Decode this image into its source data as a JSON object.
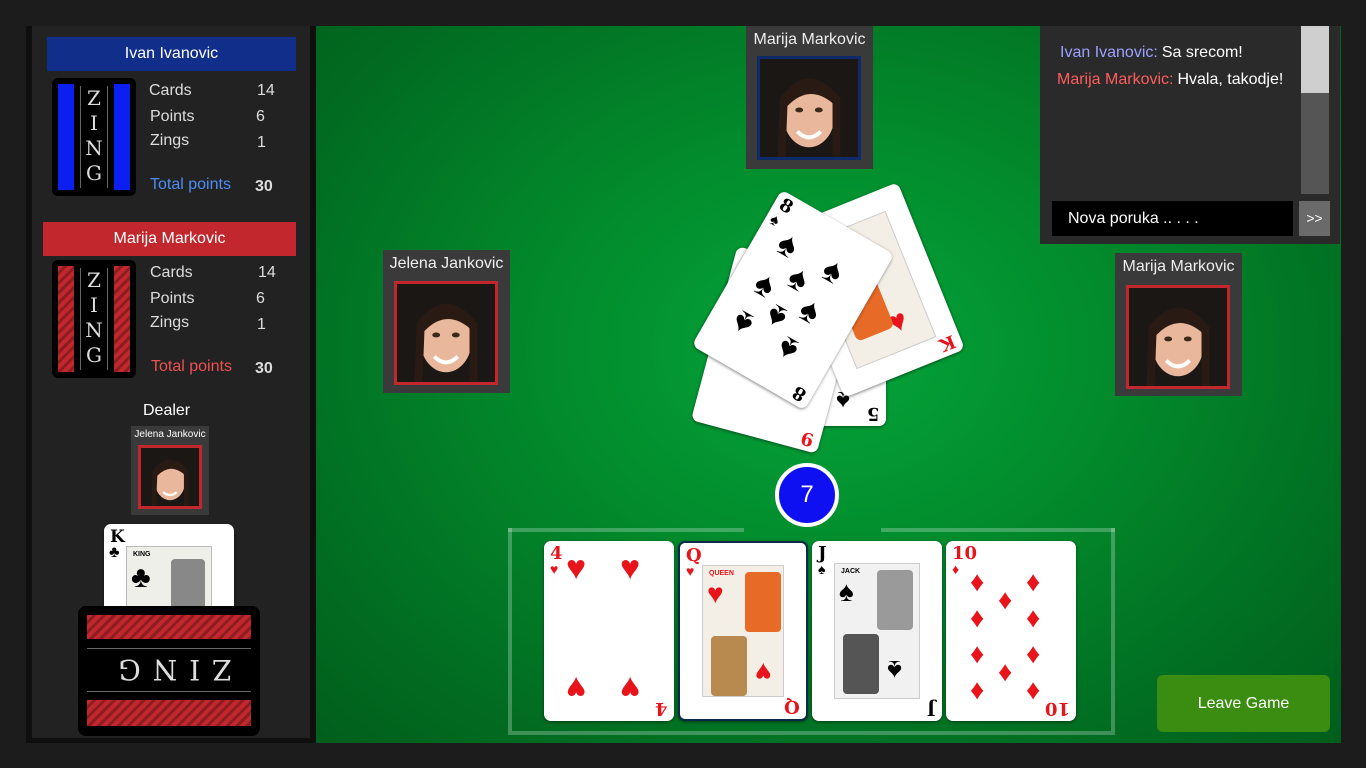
{
  "teams": [
    {
      "name": "Ivan Ivanovic",
      "header_color": "#112e8a",
      "deck_style": "blue",
      "deck_word": [
        "Z",
        "I",
        "N",
        "G"
      ],
      "stats": [
        {
          "label": "Cards",
          "value": "14"
        },
        {
          "label": "Points",
          "value": "6"
        },
        {
          "label": "Zings",
          "value": "1"
        }
      ],
      "total_label": "Total points",
      "total_value": "30",
      "total_color": "#4b8ef5"
    },
    {
      "name": "Marija Markovic",
      "header_color": "#c1272d",
      "deck_style": "red",
      "deck_word": [
        "Z",
        "I",
        "N",
        "G"
      ],
      "stats": [
        {
          "label": "Cards",
          "value": "14"
        },
        {
          "label": "Points",
          "value": "6"
        },
        {
          "label": "Zings",
          "value": "1"
        }
      ],
      "total_label": "Total points",
      "total_value": "30",
      "total_color": "#f05050"
    }
  ],
  "dealer": {
    "label": "Dealer",
    "name": "Jelena Jankovic",
    "card": {
      "rank": "K",
      "suit": "♣",
      "title": "KING"
    }
  },
  "deck_back_word": "ZING",
  "players": {
    "top": {
      "name": "Marija Markovic",
      "frame": "#0d2a6b"
    },
    "left": {
      "name": "Jelena Jankovic",
      "frame": "#c1272d"
    },
    "right": {
      "name": "Marija Markovic",
      "frame": "#c1272d"
    }
  },
  "pile": [
    {
      "rank": "5",
      "suit": "♠",
      "color": "black"
    },
    {
      "rank": "9",
      "suit": "♦",
      "color": "red"
    },
    {
      "rank": "K",
      "suit": "♥",
      "color": "red"
    },
    {
      "rank": "8",
      "suit": "♠",
      "color": "black"
    }
  ],
  "turn_counter": "7",
  "hand": [
    {
      "rank": "4",
      "suit": "♥",
      "color": "red",
      "title": ""
    },
    {
      "rank": "Q",
      "suit": "♥",
      "color": "red",
      "title": "QUEEN",
      "selected": true
    },
    {
      "rank": "J",
      "suit": "♠",
      "color": "black",
      "title": "JACK"
    },
    {
      "rank": "10",
      "suit": "♦",
      "color": "red",
      "title": ""
    }
  ],
  "chat": {
    "messages": [
      {
        "author": "Ivan Ivanovic:",
        "author_color": "#9aa2ff",
        "text": "Sa srecom!"
      },
      {
        "author": "Marija Markovic:",
        "author_color": "#ff5d5d",
        "text": "Hvala, takodje!"
      }
    ],
    "input_placeholder": "Nova poruka .. . . .",
    "send_label": ">>"
  },
  "leave_label": "Leave Game"
}
